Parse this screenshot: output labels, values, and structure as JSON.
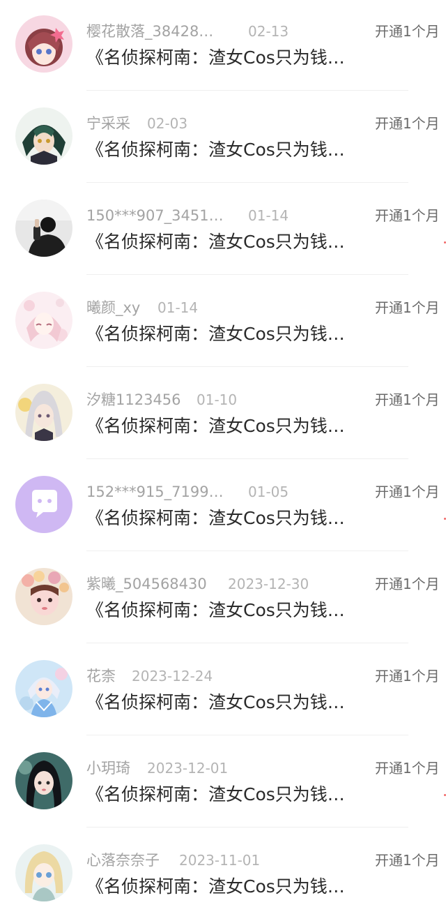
{
  "colors": {
    "meta_text": "#a3a3a3",
    "title_text": "#2a2a2a",
    "action_text": "#6a6a6a",
    "divider": "#efefef"
  },
  "items": [
    {
      "username": "樱花散落_38428…",
      "date": "02-13",
      "action": "开通1个月",
      "title": "《名侦探柯南：渣女Cos只为钱…",
      "avatar": "avatar-anime-pink-hair"
    },
    {
      "username": "宁采采",
      "date": "02-03",
      "action": "开通1个月",
      "title": "《名侦探柯南：渣女Cos只为钱…",
      "avatar": "avatar-anime-green-hair"
    },
    {
      "username": "150***907_3451…",
      "date": "01-14",
      "action": "开通1个月",
      "title": "《名侦探柯南：渣女Cos只为钱…",
      "avatar": "avatar-photo-person"
    },
    {
      "username": "曦颜_xy",
      "date": "01-14",
      "action": "开通1个月",
      "title": "《名侦探柯南：渣女Cos只为钱…",
      "avatar": "avatar-anime-pastel"
    },
    {
      "username": "汐糖1123456",
      "date": "01-10",
      "action": "开通1个月",
      "title": "《名侦探柯南：渣女Cos只为钱…",
      "avatar": "avatar-anime-silver-hair"
    },
    {
      "username": "152***915_7199…",
      "date": "01-05",
      "action": "开通1个月",
      "title": "《名侦探柯南：渣女Cos只为钱…",
      "avatar": "avatar-default-chat"
    },
    {
      "username": "紫曦_504568430",
      "date": "2023-12-30",
      "action": "开通1个月",
      "title": "《名侦探柯南：渣女Cos只为钱…",
      "avatar": "avatar-photo-flowers"
    },
    {
      "username": "花柰",
      "date": "2023-12-24",
      "action": "开通1个月",
      "title": "《名侦探柯南：渣女Cos只为钱…",
      "avatar": "avatar-anime-blue-dress"
    },
    {
      "username": "小玥琦",
      "date": "2023-12-01",
      "action": "开通1个月",
      "title": "《名侦探柯南：渣女Cos只为钱…",
      "avatar": "avatar-anime-dark-hair"
    },
    {
      "username": "心落奈奈子",
      "date": "2023-11-01",
      "action": "开通1个月",
      "title": "《名侦探柯南：渣女Cos只为钱…",
      "avatar": "avatar-anime-blonde"
    }
  ]
}
